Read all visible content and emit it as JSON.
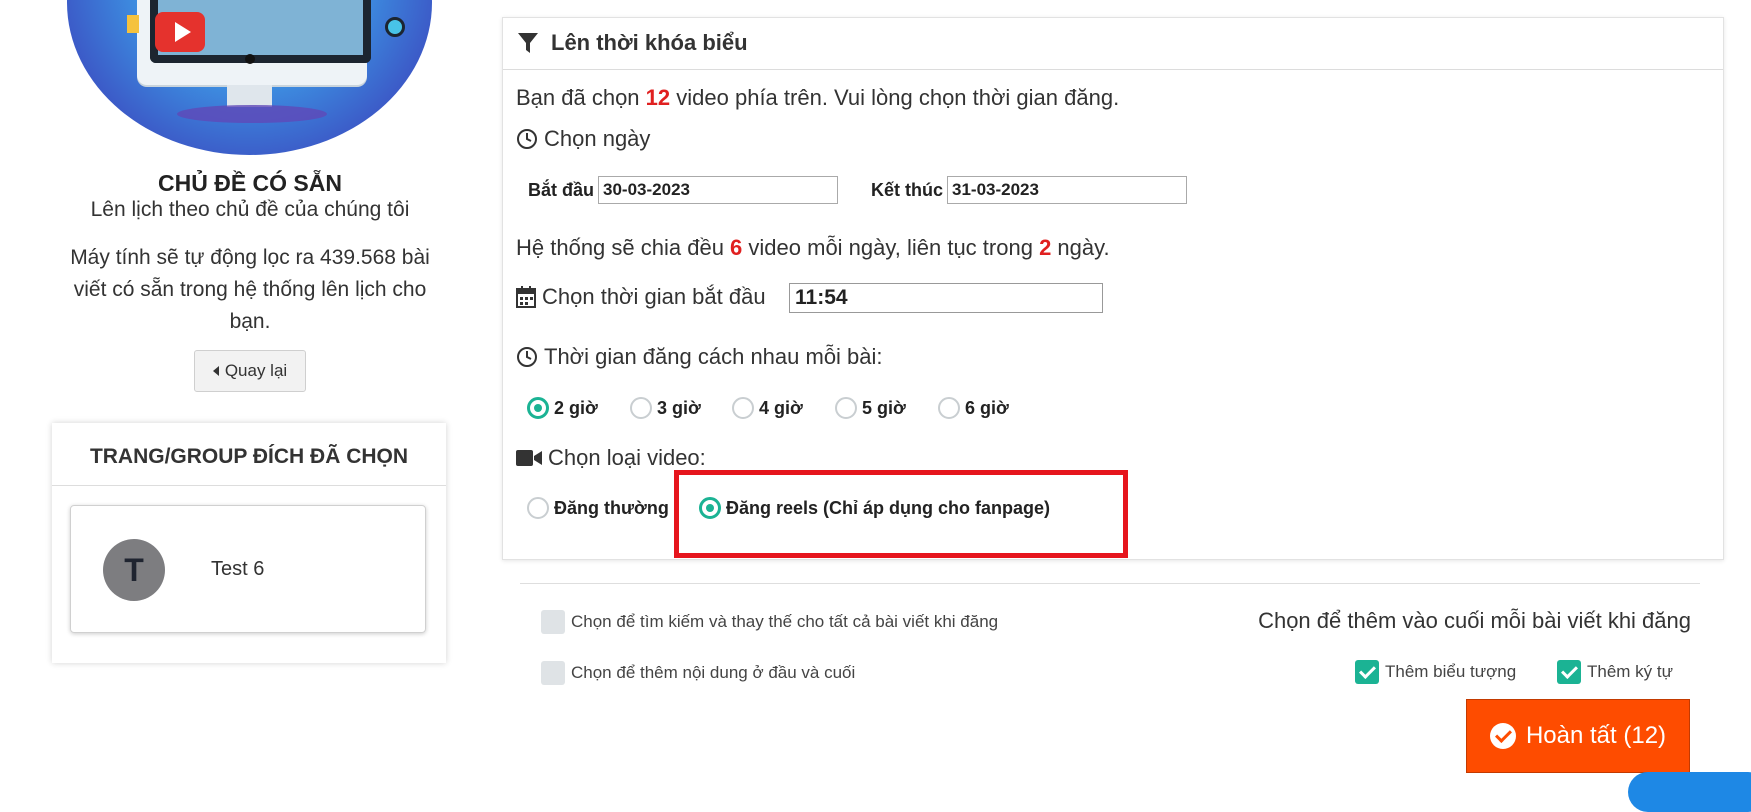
{
  "left": {
    "topic_title": "CHỦ ĐỀ CÓ SẴN",
    "topic_sub": "Lên lịch theo chủ đề của chúng tôi",
    "topic_desc": "Máy tính sẽ tự động lọc ra 439.568 bài viết có sẵn trong hệ thống lên lịch cho bạn.",
    "back_label": "Quay lại",
    "target_title": "TRANG/GROUP ĐÍCH ĐÃ CHỌN",
    "target_page": {
      "avatar_letter": "T",
      "name": "Test 6"
    }
  },
  "schedule": {
    "title": "Lên thời khóa biểu",
    "selected_prefix": "Bạn đã chọn ",
    "selected_count": "12",
    "selected_suffix": " video phía trên. Vui lòng chọn thời gian đăng.",
    "choose_date_label": "Chọn ngày",
    "start_label": "Bắt đầu",
    "start_value": "30-03-2023",
    "end_label": "Kết thúc",
    "end_value": "31-03-2023",
    "split_prefix": "Hệ thống sẽ chia đều ",
    "split_per_day": "6",
    "split_middle": " video mỗi ngày, liên tục trong ",
    "split_days": "2",
    "split_suffix": " ngày.",
    "start_time_label": "Chọn thời gian bắt đầu",
    "start_time_value": "11:54",
    "interval_label": "Thời gian đăng cách nhau mỗi bài:",
    "interval_options": [
      "2 giờ",
      "3 giờ",
      "4 giờ",
      "5 giờ",
      "6 giờ"
    ],
    "interval_selected": "2 giờ",
    "video_type_label": "Chọn loại video:",
    "video_types": [
      "Đăng thường",
      "Đăng reels (Chỉ áp dụng cho fanpage)"
    ],
    "video_type_selected": "Đăng reels (Chỉ áp dụng cho fanpage)"
  },
  "options": {
    "search_replace_label": "Chọn để tìm kiếm và thay thế cho tất cả bài viết khi đăng",
    "search_replace_checked": false,
    "head_tail_label": "Chọn để thêm nội dung ở đầu và cuối",
    "head_tail_checked": false,
    "append_title": "Chọn để thêm vào cuối mỗi bài viết khi đăng",
    "add_icon_label": "Thêm biểu tượng",
    "add_icon_checked": true,
    "add_char_label": "Thêm ký tự",
    "add_char_checked": true
  },
  "done_button": "Hoàn tất (12)",
  "colors": {
    "accent": "#1bb394",
    "highlight": "#e02020",
    "done": "#fe4c00",
    "frame": "#e6151d"
  }
}
